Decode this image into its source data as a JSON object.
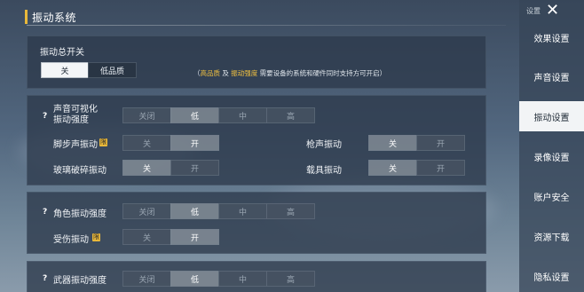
{
  "header": {
    "title": "振动系统"
  },
  "master": {
    "label": "振动总开关",
    "options": [
      "关",
      "低品质"
    ],
    "selected": "关",
    "note_open": "（",
    "note_hl1": "高品质",
    "note_and": " 及 ",
    "note_hl2": "振动强度",
    "note_rest": " 需要设备的系统和硬件同时支持方可开启）"
  },
  "sound_panel": {
    "visual_label_line1": "声音可视化",
    "visual_label_line2": "振动强度",
    "intensity_options": [
      "关闭",
      "低",
      "中",
      "高"
    ],
    "intensity_selected": "低",
    "footstep_label": "脚步声振动",
    "footstep_badge": "限",
    "footstep_options": [
      "关",
      "开"
    ],
    "footstep_selected": "开",
    "gunshot_label": "枪声振动",
    "gunshot_options": [
      "关",
      "开"
    ],
    "gunshot_selected": "关",
    "glass_label": "玻璃破碎振动",
    "glass_options": [
      "关",
      "开"
    ],
    "glass_selected": "关",
    "vehicle_label": "载具振动",
    "vehicle_options": [
      "关",
      "开"
    ],
    "vehicle_selected": "关"
  },
  "character_panel": {
    "intensity_label": "角色振动强度",
    "intensity_options": [
      "关闭",
      "低",
      "中",
      "高"
    ],
    "intensity_selected": "低",
    "hurt_label": "受伤振动",
    "hurt_badge": "限",
    "hurt_options": [
      "关",
      "开"
    ],
    "hurt_selected": "开"
  },
  "weapon_panel": {
    "intensity_label": "武器振动强度",
    "intensity_options": [
      "关闭",
      "低",
      "中",
      "高"
    ],
    "intensity_selected": "低"
  },
  "sidebar": {
    "title": "设置",
    "close_icon": "close-icon",
    "items": [
      "效果设置",
      "声音设置",
      "振动设置",
      "录像设置",
      "账户安全",
      "资源下载",
      "隐私设置"
    ],
    "active": "振动设置"
  }
}
